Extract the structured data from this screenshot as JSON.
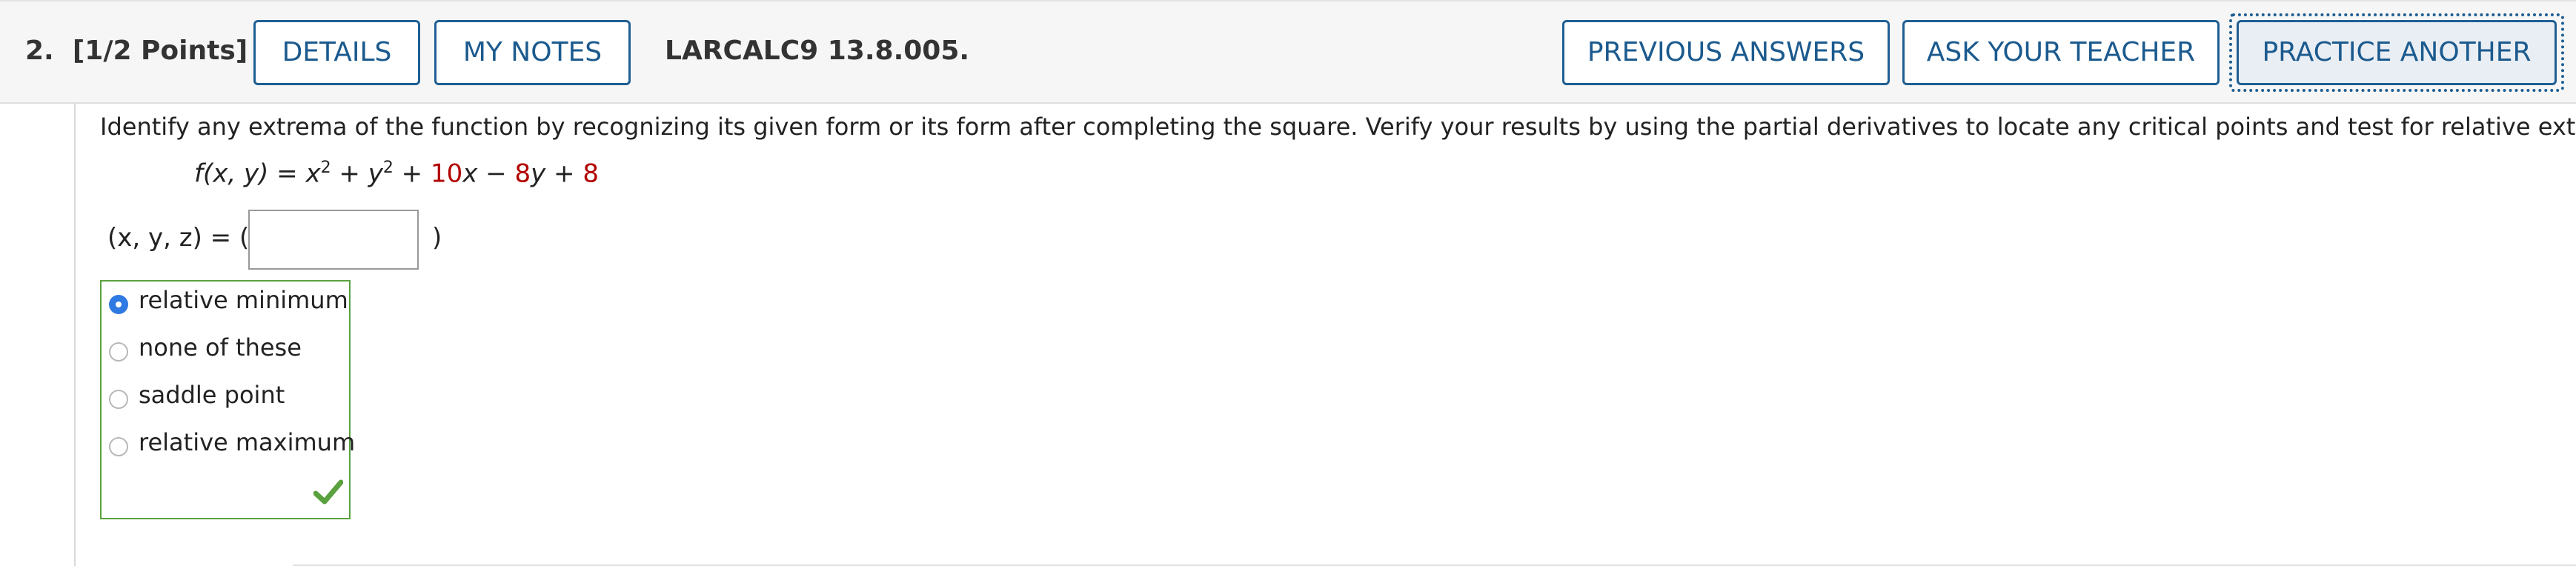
{
  "header": {
    "question_number": "2.",
    "points": "[1/2 Points]",
    "details_label": "DETAILS",
    "notes_label": "MY NOTES",
    "problem_id": "LARCALC9 13.8.005.",
    "previous_answers_label": "PREVIOUS ANSWERS",
    "ask_teacher_label": "ASK YOUR TEACHER",
    "practice_another_label": "PRACTICE ANOTHER"
  },
  "question": {
    "instructions": "Identify any extrema of the function by recognizing its given form or its form after completing the square. Verify your results by using the partial derivatives to locate any critical points and test for relative extrema.",
    "function": {
      "lhs": "f(x, y) = ",
      "t1_base": "x",
      "t1_exp": "2",
      "plus1": " + ",
      "t2_base": "y",
      "t2_exp": "2",
      "plus2": " + ",
      "coef1": "10",
      "var1": "x",
      "minus": " − ",
      "coef2": "8",
      "var2": "y",
      "plus3": " + ",
      "const": "8"
    },
    "answer_label": "(x, y, z) = (",
    "answer_close": ")",
    "answer_value": ""
  },
  "choices": [
    {
      "label": "relative minimum",
      "selected": true
    },
    {
      "label": "none of these",
      "selected": false
    },
    {
      "label": "saddle point",
      "selected": false
    },
    {
      "label": "relative maximum",
      "selected": false
    }
  ],
  "result_icon": "checkmark-icon",
  "colors": {
    "button_blue": "#1f5f93",
    "given_value_red": "#b30000",
    "correct_green": "#5aa13f",
    "radio_selected": "#2f79e2"
  }
}
